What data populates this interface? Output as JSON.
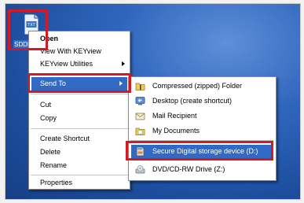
{
  "desktop": {
    "file_icon_label": "SDDL",
    "file_icon_text": "TXT"
  },
  "context_menu": {
    "items": [
      {
        "label": "Open"
      },
      {
        "label": "View With KEYview"
      },
      {
        "label": "KEYview Utilities"
      },
      {
        "label": "Send To"
      },
      {
        "label": "Cut"
      },
      {
        "label": "Copy"
      },
      {
        "label": "Create Shortcut"
      },
      {
        "label": "Delete"
      },
      {
        "label": "Rename"
      },
      {
        "label": "Properties"
      }
    ]
  },
  "send_to_menu": {
    "items": [
      {
        "label": "Compressed (zipped) Folder",
        "icon": "zip-folder-icon"
      },
      {
        "label": "Desktop (create shortcut)",
        "icon": "desktop-icon"
      },
      {
        "label": "Mail Recipient",
        "icon": "mail-icon"
      },
      {
        "label": "My Documents",
        "icon": "my-documents-folder-icon"
      },
      {
        "label": "Secure Digital storage device (D:)",
        "icon": "sd-card-icon"
      },
      {
        "label": "DVD/CD-RW Drive (Z:)",
        "icon": "dvd-drive-icon"
      }
    ]
  },
  "colors": {
    "desktop_background": "#2f66bd",
    "selection": "#316ac5",
    "highlight_box": "#d11a25"
  }
}
